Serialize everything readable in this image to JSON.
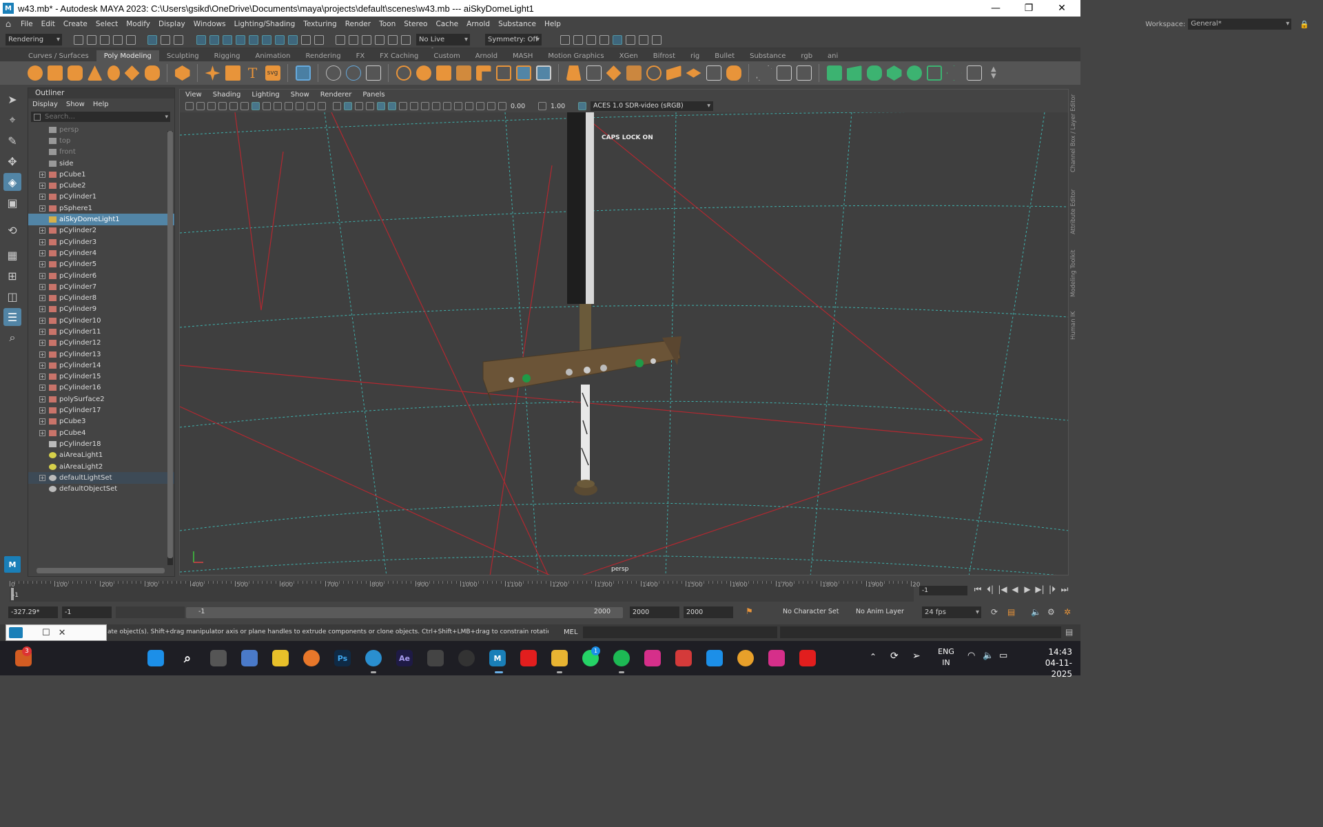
{
  "window": {
    "title": "w43.mb* - Autodesk MAYA 2023: C:\\Users\\gsikd\\OneDrive\\Documents\\maya\\projects\\default\\scenes\\w43.mb   ---   aiSkyDomeLight1",
    "logo": "M",
    "minimize": "—",
    "maximize": "❐",
    "close": "✕"
  },
  "menubar": [
    "File",
    "Edit",
    "Create",
    "Select",
    "Modify",
    "Display",
    "Windows",
    "Lighting/Shading",
    "Texturing",
    "Render",
    "Toon",
    "Stereo",
    "Cache",
    "Arnold",
    "Substance",
    "Help"
  ],
  "workspace": {
    "label": "Workspace:",
    "value": "General*"
  },
  "statusline": {
    "menuset": "Rendering",
    "live_surface": "No Live Surface",
    "symmetry": "Symmetry: Off"
  },
  "shelf_tabs": [
    "Curves / Surfaces",
    "Poly Modeling",
    "Sculpting",
    "Rigging",
    "Animation",
    "Rendering",
    "FX",
    "FX Caching",
    "Custom",
    "Arnold",
    "MASH",
    "Motion Graphics",
    "XGen",
    "Bifrost",
    "rig",
    "Bullet",
    "Substance",
    "rgb",
    "ani"
  ],
  "shelf_active": "Poly Modeling",
  "shelf_text_icons": {
    "text_tool": "T",
    "svg_tool": "svg"
  },
  "outliner": {
    "title": "Outliner",
    "menu": [
      "Display",
      "Show",
      "Help"
    ],
    "search_placeholder": "Search...",
    "items": [
      {
        "label": "persp",
        "type": "camera",
        "expand": false,
        "dim": true
      },
      {
        "label": "top",
        "type": "camera",
        "expand": false,
        "dim": true
      },
      {
        "label": "front",
        "type": "camera",
        "expand": false,
        "dim": true
      },
      {
        "label": "side",
        "type": "camera",
        "expand": false,
        "dim": false
      },
      {
        "label": "pCube1",
        "type": "mesh",
        "expand": true
      },
      {
        "label": "pCube2",
        "type": "mesh",
        "expand": true
      },
      {
        "label": "pCylinder1",
        "type": "mesh",
        "expand": true
      },
      {
        "label": "pSphere1",
        "type": "mesh",
        "expand": true
      },
      {
        "label": "aiSkyDomeLight1",
        "type": "light",
        "expand": false,
        "selected": true
      },
      {
        "label": "pCylinder2",
        "type": "mesh",
        "expand": true
      },
      {
        "label": "pCylinder3",
        "type": "mesh",
        "expand": true
      },
      {
        "label": "pCylinder4",
        "type": "mesh",
        "expand": true
      },
      {
        "label": "pCylinder5",
        "type": "mesh",
        "expand": true
      },
      {
        "label": "pCylinder6",
        "type": "mesh",
        "expand": true
      },
      {
        "label": "pCylinder7",
        "type": "mesh",
        "expand": true
      },
      {
        "label": "pCylinder8",
        "type": "mesh",
        "expand": true
      },
      {
        "label": "pCylinder9",
        "type": "mesh",
        "expand": true
      },
      {
        "label": "pCylinder10",
        "type": "mesh",
        "expand": true
      },
      {
        "label": "pCylinder11",
        "type": "mesh",
        "expand": true
      },
      {
        "label": "pCylinder12",
        "type": "mesh",
        "expand": true
      },
      {
        "label": "pCylinder13",
        "type": "mesh",
        "expand": true
      },
      {
        "label": "pCylinder14",
        "type": "mesh",
        "expand": true
      },
      {
        "label": "pCylinder15",
        "type": "mesh",
        "expand": true
      },
      {
        "label": "pCylinder16",
        "type": "mesh",
        "expand": true
      },
      {
        "label": "polySurface2",
        "type": "mesh",
        "expand": true
      },
      {
        "label": "pCylinder17",
        "type": "mesh",
        "expand": true
      },
      {
        "label": "pCube3",
        "type": "mesh",
        "expand": true
      },
      {
        "label": "pCube4",
        "type": "mesh",
        "expand": true
      },
      {
        "label": "pCylinder18",
        "type": "transform",
        "expand": false
      },
      {
        "label": "aiAreaLight1",
        "type": "arealight",
        "expand": false
      },
      {
        "label": "aiAreaLight2",
        "type": "arealight",
        "expand": false
      },
      {
        "label": "defaultLightSet",
        "type": "set",
        "expand": true,
        "highlight": true
      },
      {
        "label": "defaultObjectSet",
        "type": "set",
        "expand": false
      }
    ]
  },
  "viewport": {
    "menu": [
      "View",
      "Shading",
      "Lighting",
      "Show",
      "Renderer",
      "Panels"
    ],
    "exposure": "0.00",
    "gamma": "1.00",
    "color_space": "ACES 1.0 SDR-video (sRGB)",
    "hud_caps": "CAPS LOCK ON",
    "camera": "persp",
    "axis_x": "x",
    "axis_y": "y"
  },
  "right_tabs": [
    "Channel Box / Layer Editor",
    "Attribute Editor",
    "Modeling Toolkit",
    "Human IK"
  ],
  "timeslider": {
    "ticks": [
      "0",
      "100",
      "200",
      "300",
      "400",
      "500",
      "600",
      "700",
      "800",
      "900",
      "1000",
      "1100",
      "1200",
      "1300",
      "1400",
      "1500",
      "1600",
      "1700",
      "1800",
      "1900",
      "20"
    ],
    "start_marker": "-1",
    "current_frame": "-1",
    "controls": [
      "⏮",
      "⏴|",
      "|◀",
      "◀",
      "▶",
      "▶|",
      "|⏵",
      "⏭"
    ]
  },
  "rangeslider": {
    "value_field": "-327.29*",
    "start": "-1",
    "range_start": "-1",
    "range_end": "2000",
    "end1": "2000",
    "end2": "2000",
    "character_set": "No Character Set",
    "anim_layer": "No Anim Layer",
    "fps": "24 fps"
  },
  "helpline": {
    "text": "ate object(s). Shift+drag manipulator axis or plane handles to extrude components or clone objects. Ctrl+Shift+LMB+drag to constrain rotation to connected edges. Use D or INSE",
    "mel": "MEL"
  },
  "taskbar": {
    "notif_badge": "3",
    "whatsapp_badge": "1",
    "apps_text": {
      "ps": "Ps",
      "ae": "Ae",
      "maya": "M"
    },
    "lang1": "ENG",
    "lang2": "IN",
    "time": "14:43",
    "date": "04-11-2025"
  },
  "colors": {
    "accent": "#5285a6",
    "grid": "#3fc9c4",
    "light_lines": "#c8242e"
  }
}
